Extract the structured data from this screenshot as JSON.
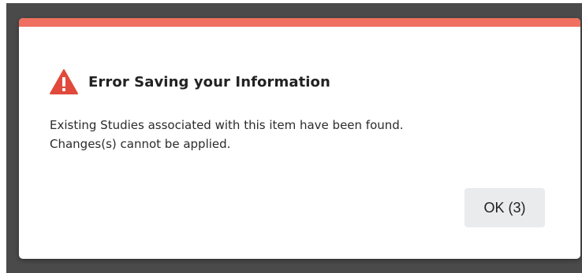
{
  "dialog": {
    "title": "Error Saving your Information",
    "icon": "warning-triangle-icon",
    "message_lines": [
      "Existing Studies associated with this item have been found.",
      "Changes(s) cannot be applied."
    ],
    "ok_label": "OK (3)",
    "accent_color": "#ef6f60",
    "icon_color": "#e0493b"
  }
}
